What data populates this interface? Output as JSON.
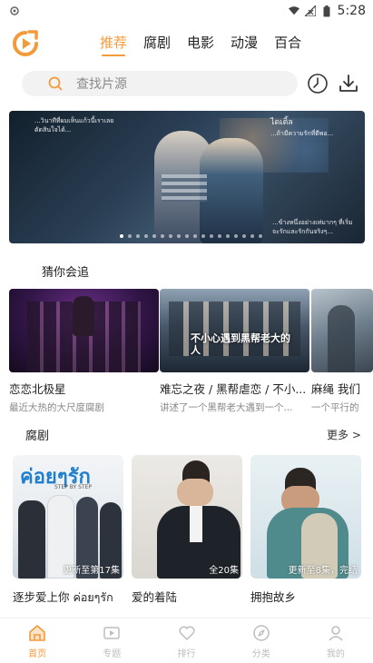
{
  "status_bar": {
    "time": "5:28",
    "icons": [
      "notification-icon",
      "wifi-icon",
      "signal-icon",
      "battery-icon"
    ]
  },
  "header": {
    "tabs": [
      {
        "label": "推荐",
        "active": true
      },
      {
        "label": "腐剧",
        "active": false
      },
      {
        "label": "电影",
        "active": false
      },
      {
        "label": "动漫",
        "active": false
      },
      {
        "label": "百合",
        "active": false
      }
    ]
  },
  "search": {
    "placeholder": "查找片源"
  },
  "banner": {
    "caption_left": "...วินาทีที่ผมเห็นแก้วนี้เราเลยตัดสินใจได้...",
    "caption_right_title": "ไดเติ้ล",
    "caption_right_sub": "...ถ้ามีความรักที่ดีพอ...",
    "caption_bottom": "...ข้างหนึ่งอย่างเท่มากๆ ที่เริ่มจะรักและรักกันจริงๆ..."
  },
  "guess": {
    "title": "猜你会追",
    "items": [
      {
        "title": "恋恋北极星",
        "subtitle": "最近大热的大尺度腐剧"
      },
      {
        "title": "难忘之夜 / 黑帮虐恋 / 不小...",
        "subtitle": "讲述了一个黑帮老大遇到一个..."
      },
      {
        "title": "麻绳 我们",
        "subtitle": "一个平行的"
      }
    ],
    "poster_text_2": "不小心遇到黑帮老大的人"
  },
  "section_bl": {
    "title": "腐剧",
    "more": "更多 >",
    "items": [
      {
        "title": "逐步爱上你 ค่อยๆรัก",
        "badge": "更新至第17集",
        "poster_text": "ค่อยๆรัก",
        "poster_sub": "STEP BY STEP"
      },
      {
        "title": "爱的着陆",
        "badge": "全20集"
      },
      {
        "title": "拥抱故乡",
        "badge": "更新至8集，完结"
      }
    ]
  },
  "bottom_nav": [
    {
      "label": "首页",
      "icon": "home-icon",
      "active": true
    },
    {
      "label": "专题",
      "icon": "topic-icon",
      "active": false
    },
    {
      "label": "排行",
      "icon": "heart-icon",
      "active": false
    },
    {
      "label": "分类",
      "icon": "category-icon",
      "active": false
    },
    {
      "label": "我的",
      "icon": "profile-icon",
      "active": false
    }
  ],
  "colors": {
    "accent": "#f39a3a",
    "muted": "#bdbdbd",
    "search_bg": "#f2f2f2"
  }
}
